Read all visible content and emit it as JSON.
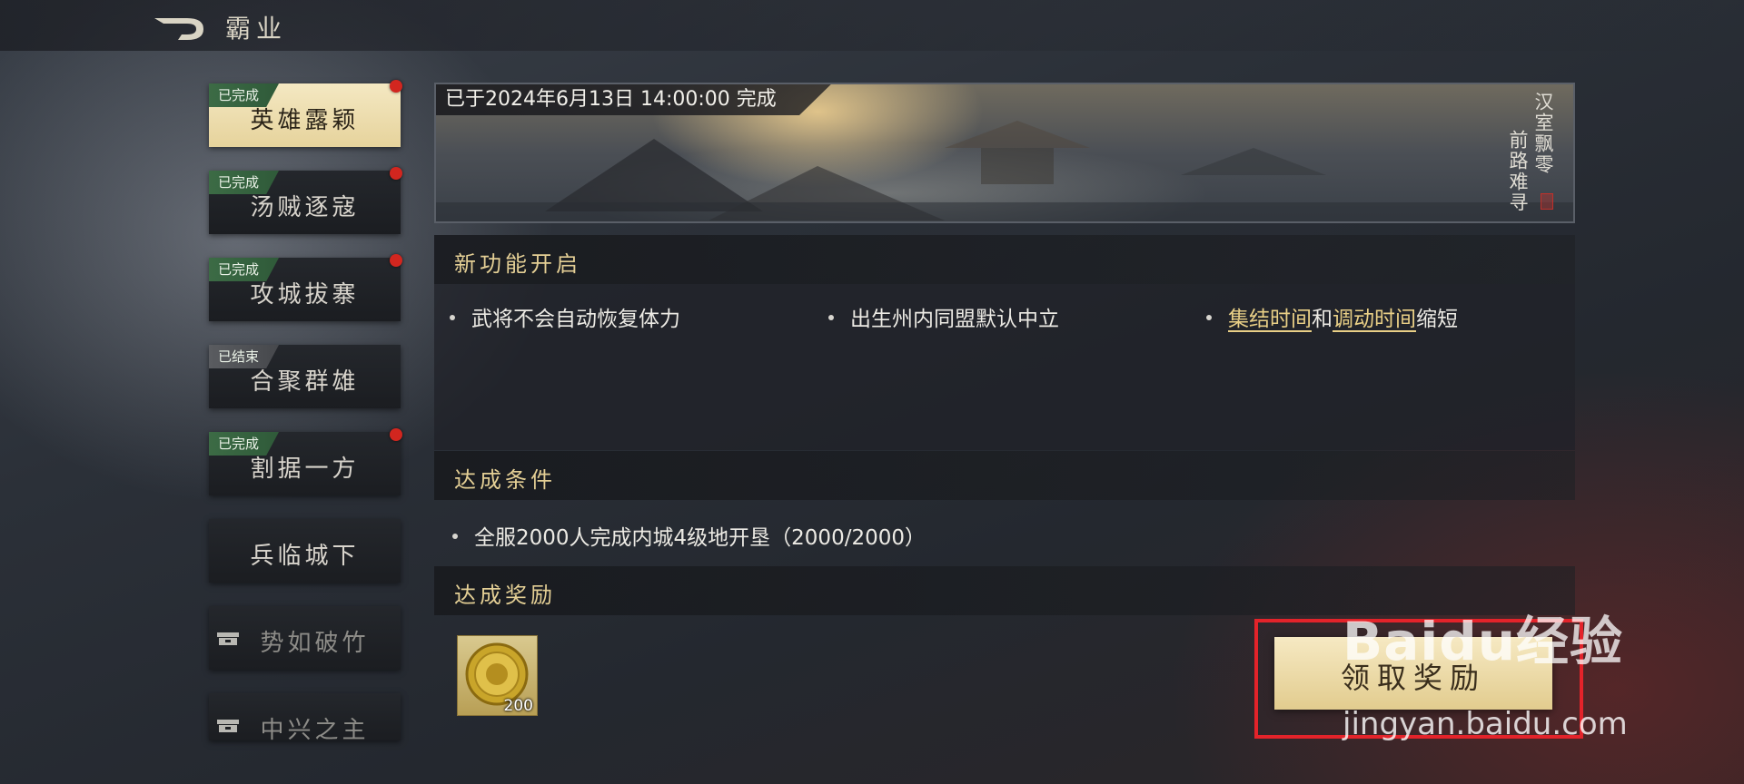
{
  "header": {
    "title": "霸业"
  },
  "sidebar": {
    "items": [
      {
        "label": "英雄露颖",
        "badge": "已完成",
        "badge_type": "done",
        "red_dot": true,
        "active": true
      },
      {
        "label": "汤贼逐寇",
        "badge": "已完成",
        "badge_type": "done",
        "red_dot": true
      },
      {
        "label": "攻城拔寨",
        "badge": "已完成",
        "badge_type": "done",
        "red_dot": true
      },
      {
        "label": "合聚群雄",
        "badge": "已结束",
        "badge_type": "ended",
        "red_dot": false
      },
      {
        "label": "割据一方",
        "badge": "已完成",
        "badge_type": "done",
        "red_dot": true
      },
      {
        "label": "兵临城下",
        "badge": "",
        "red_dot": false
      },
      {
        "label": "势如破竹",
        "locked": true
      },
      {
        "label": "中兴之主",
        "locked": true
      }
    ]
  },
  "banner": {
    "status": "已于2024年6月13日 14:00:00 完成",
    "poem_col1": "汉室飘零",
    "poem_col2": "前路难寻"
  },
  "new_features": {
    "title": "新功能开启",
    "item1": "武将不会自动恢复体力",
    "item2": "出生州内同盟默认中立",
    "item3_hl1": "集结时间",
    "item3_mid": "和",
    "item3_hl2": "调动时间",
    "item3_tail": "缩短"
  },
  "conditions": {
    "title": "达成条件",
    "item1": "全服2000人完成内城4级地开垦（2000/2000）"
  },
  "rewards": {
    "title": "达成奖励",
    "items": [
      {
        "icon": "gold-coin-icon",
        "count": "200"
      }
    ],
    "claim_label": "领取奖励"
  },
  "watermark": {
    "logo": "Baidu经验",
    "url": "jingyan.baidu.com"
  },
  "colors": {
    "accent_gold": "#e4cf95",
    "badge_green": "#3c6b45",
    "red_dot": "#d2261f",
    "highlight": "#e3232a"
  }
}
